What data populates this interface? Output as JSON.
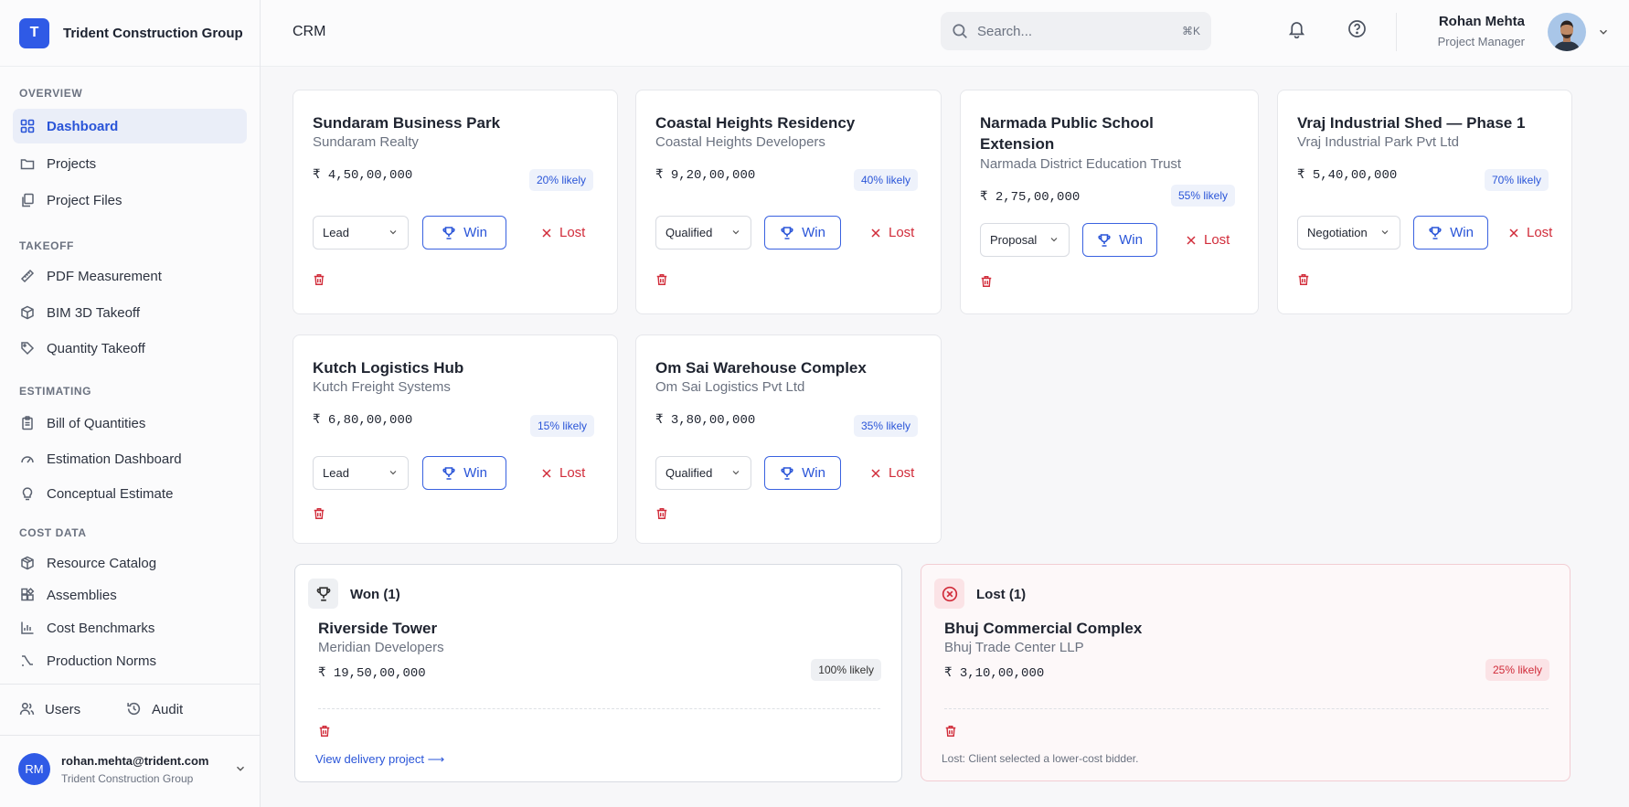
{
  "sidebar": {
    "brand_initial": "T",
    "brand_name": "Trident Construction Group",
    "sections": [
      {
        "title": "OVERVIEW",
        "items": [
          {
            "label": "Dashboard",
            "icon": "grid-icon",
            "active": true
          },
          {
            "label": "Projects",
            "icon": "folder-icon"
          },
          {
            "label": "Project Files",
            "icon": "files-icon"
          }
        ]
      },
      {
        "title": "TAKEOFF",
        "items": [
          {
            "label": "PDF Measurement",
            "icon": "ruler-icon"
          },
          {
            "label": "BIM 3D Takeoff",
            "icon": "cube-icon"
          },
          {
            "label": "Quantity Takeoff",
            "icon": "tag-icon"
          }
        ]
      },
      {
        "title": "ESTIMATING",
        "items": [
          {
            "label": "Bill of Quantities",
            "icon": "clipboard-icon"
          },
          {
            "label": "Estimation Dashboard",
            "icon": "gauge-icon"
          },
          {
            "label": "Conceptual Estimate",
            "icon": "bulb-icon"
          }
        ]
      },
      {
        "title": "COST DATA",
        "items": [
          {
            "label": "Resource Catalog",
            "icon": "package-icon"
          },
          {
            "label": "Assemblies",
            "icon": "blocks-icon"
          },
          {
            "label": "Cost Benchmarks",
            "icon": "bar-chart-icon"
          },
          {
            "label": "Production Norms",
            "icon": "trend-icon"
          }
        ]
      }
    ],
    "users_label": "Users",
    "audit_label": "Audit",
    "user_initials": "RM",
    "user_email": "rohan.mehta@trident.com",
    "user_org": "Trident Construction Group"
  },
  "header": {
    "title": "CRM",
    "search_placeholder": "Search...",
    "search_shortcut": "⌘K",
    "user_name": "Rohan Mehta",
    "user_role": "Project Manager"
  },
  "labels": {
    "win": "Win",
    "lost": "Lost"
  },
  "opportunities": [
    {
      "title": "Sundaram Business Park",
      "client": "Sundaram Realty",
      "amount": "₹ 4,50,00,000",
      "likely": "20% likely",
      "stage": "Lead"
    },
    {
      "title": "Coastal Heights Residency",
      "client": "Coastal Heights Developers",
      "amount": "₹ 9,20,00,000",
      "likely": "40% likely",
      "stage": "Qualified"
    },
    {
      "title": "Narmada Public School Extension",
      "client": "Narmada District Education Trust",
      "amount": "₹ 2,75,00,000",
      "likely": "55% likely",
      "stage": "Proposal"
    },
    {
      "title": "Vraj Industrial Shed — Phase 1",
      "client": "Vraj Industrial Park Pvt Ltd",
      "amount": "₹ 5,40,00,000",
      "likely": "70% likely",
      "stage": "Negotiation"
    },
    {
      "title": "Kutch Logistics Hub",
      "client": "Kutch Freight Systems",
      "amount": "₹ 6,80,00,000",
      "likely": "15% likely",
      "stage": "Lead"
    },
    {
      "title": "Om Sai Warehouse Complex",
      "client": "Om Sai Logistics Pvt Ltd",
      "amount": "₹ 3,80,00,000",
      "likely": "35% likely",
      "stage": "Qualified"
    }
  ],
  "won": {
    "title": "Won (1)",
    "name": "Riverside Tower",
    "client": "Meridian Developers",
    "amount": "₹ 19,50,00,000",
    "likely": "100% likely",
    "link": "View delivery project ⟶"
  },
  "lost": {
    "title": "Lost (1)",
    "name": "Bhuj Commercial Complex",
    "client": "Bhuj Trade Center LLP",
    "amount": "₹ 3,10,00,000",
    "likely": "25% likely",
    "reason": "Lost: Client selected a lower-cost bidder."
  }
}
